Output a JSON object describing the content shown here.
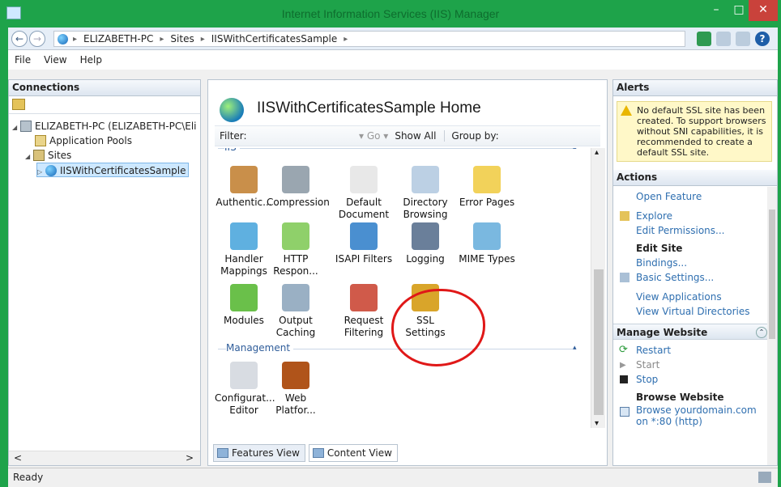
{
  "window": {
    "title": "Internet Information Services (IIS) Manager",
    "min": "–",
    "max": "□",
    "close": "✕"
  },
  "address": {
    "crumbs": [
      "ELIZABETH-PC",
      "Sites",
      "IISWithCertificatesSample"
    ],
    "separator": "▸",
    "back": "←",
    "forward": "→",
    "help": "?"
  },
  "menu": [
    "File",
    "View",
    "Help"
  ],
  "connections": {
    "title": "Connections",
    "tree": [
      {
        "label": "ELIZABETH-PC (ELIZABETH-PC\\Eli",
        "arrow": "◢"
      },
      {
        "label": "Application Pools"
      },
      {
        "label": "Sites",
        "arrow": "◢"
      },
      {
        "label": "IISWithCertificatesSample",
        "arrow": "▷",
        "selected": true
      }
    ],
    "scroll_left": "<",
    "scroll_right": ">"
  },
  "center": {
    "title": "IISWithCertificatesSample Home",
    "filter_label": "Filter:",
    "go": "▾ Go ▾",
    "show_all": "Show All",
    "group_by": "Group by:",
    "groups": [
      {
        "name": "IIS",
        "features": [
          {
            "label": "Authentic...",
            "icon": "authentication-icon",
            "color": "#c98f4a"
          },
          {
            "label": "Compression",
            "icon": "compression-icon",
            "color": "#9aa6b0"
          },
          {
            "label": "Default Document",
            "icon": "default-document-icon",
            "color": "#e8e8e8"
          },
          {
            "label": "Directory Browsing",
            "icon": "directory-browsing-icon",
            "color": "#bcd0e4"
          },
          {
            "label": "Error Pages",
            "icon": "error-pages-icon",
            "color": "#f2d25a"
          },
          {
            "label": "Handler Mappings",
            "icon": "handler-mappings-icon",
            "color": "#5fb0e0"
          },
          {
            "label": "HTTP Respon...",
            "icon": "http-response-icon",
            "color": "#8fd06a"
          },
          {
            "label": "ISAPI Filters",
            "icon": "isapi-filters-icon",
            "color": "#4a8fd0"
          },
          {
            "label": "Logging",
            "icon": "logging-icon",
            "color": "#6a7f9a"
          },
          {
            "label": "MIME Types",
            "icon": "mime-types-icon",
            "color": "#7ab8e0"
          },
          {
            "label": "Modules",
            "icon": "modules-icon",
            "color": "#6ac04a"
          },
          {
            "label": "Output Caching",
            "icon": "output-caching-icon",
            "color": "#9ab0c4"
          },
          {
            "label": "Request Filtering",
            "icon": "request-filtering-icon",
            "color": "#d05a4a"
          },
          {
            "label": "SSL Settings",
            "icon": "ssl-settings-lock-icon",
            "color": "#d9a52a"
          }
        ]
      },
      {
        "name": "Management",
        "features": [
          {
            "label": "Configurat... Editor",
            "icon": "configuration-editor-icon",
            "color": "#d8dce2"
          },
          {
            "label": "Web Platfor...",
            "icon": "web-platform-installer-icon",
            "color": "#b0541a"
          }
        ]
      }
    ],
    "collapse_chevron": "▴",
    "views": [
      "Features View",
      "Content View"
    ]
  },
  "alerts": {
    "title": "Alerts",
    "message": "No default SSL site has been created. To support browsers without SNI capabilities, it is recommended to create a default SSL site."
  },
  "actions": {
    "title": "Actions",
    "open_feature": "Open Feature",
    "explore": "Explore",
    "edit_permissions": "Edit Permissions...",
    "edit_site": "Edit Site",
    "bindings": "Bindings...",
    "basic_settings": "Basic Settings...",
    "view_applications": "View Applications",
    "view_virtual_directories": "View Virtual Directories",
    "manage_website": "Manage Website",
    "restart": "Restart",
    "start": "Start",
    "stop": "Stop",
    "browse_website": "Browse Website",
    "browse_link": "Browse yourdomain.com on *:80 (http)",
    "collapse_glyph": "⌃"
  },
  "status": "Ready",
  "colors": {
    "title_bar": "#1ea34a",
    "link": "#2f6fb0",
    "highlight_ring": "#e01818",
    "alert_bg": "#fff8c8"
  }
}
